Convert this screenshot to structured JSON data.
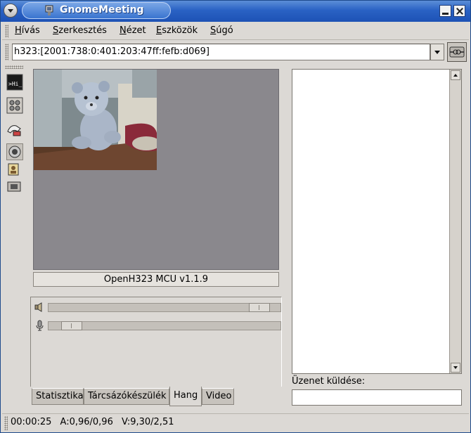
{
  "window": {
    "title": "GnomeMeeting"
  },
  "menu": [
    {
      "pre": "",
      "key": "H",
      "post": "ívás"
    },
    {
      "pre": "",
      "key": "S",
      "post": "zerkesztés"
    },
    {
      "pre": "",
      "key": "N",
      "post": "ézet"
    },
    {
      "pre": "",
      "key": "E",
      "post": "szközök"
    },
    {
      "pre": "",
      "key": "S",
      "post": "úgó"
    }
  ],
  "address": {
    "value": "h323:[2001:738:0:401:203:47ff:fefb:d069]"
  },
  "video": {
    "caption": "OpenH323 MCU v1.1.9"
  },
  "audio": {
    "speaker_volume": 0.95,
    "mic_volume": 0.06
  },
  "tabs": [
    "Statisztika",
    "Tárcsázókészülék",
    "Hang",
    "Video"
  ],
  "active_tab": "Hang",
  "chat": {
    "send_label": "Üzenet küldése:"
  },
  "status": {
    "time": "00:00:25",
    "audio": "A:0,96/0,96",
    "video": "V:9,30/2,51"
  }
}
